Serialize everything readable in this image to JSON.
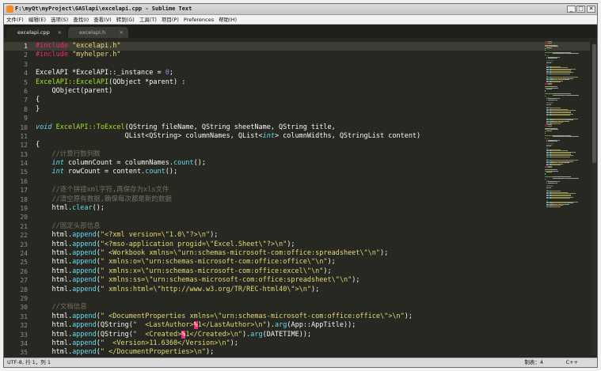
{
  "window": {
    "title": "F:\\myQt\\myProject\\GASlapi\\excelapi.cpp - Sublime Text",
    "buttons": {
      "minimize": "_",
      "maximize": "□",
      "close": "✕"
    }
  },
  "menu": [
    "文件(F)",
    "编辑(E)",
    "选项(S)",
    "查找(I)",
    "查看(V)",
    "转到(G)",
    "工具(T)",
    "项目(P)",
    "Preferences",
    "帮助(H)"
  ],
  "tabs": [
    {
      "label": "excelapi.cpp",
      "close": "×"
    },
    {
      "label": "excelapi.h",
      "close": "×"
    }
  ],
  "editor": {
    "colors": {
      "background": "#272822",
      "keyword": "#f92672",
      "string": "#e6db74",
      "number": "#ae81ff",
      "comment": "#75715e",
      "function": "#a6e22e",
      "type": "#66d9ef",
      "text": "#f8f8f2"
    },
    "line_numbers": [
      "1",
      "2",
      "3",
      "4",
      "5",
      "6",
      "7",
      "8",
      "9",
      "10",
      "11",
      "12",
      "13",
      "14",
      "15",
      "16",
      "17",
      "18",
      "19",
      "20",
      "21",
      "22",
      "23",
      "24",
      "25",
      "26",
      "27",
      "28",
      "29",
      "30",
      "31",
      "32",
      "33",
      "34",
      "35"
    ],
    "lines": [
      [
        [
          "#include ",
          "k"
        ],
        [
          "\"excelapi.h\"",
          "s"
        ]
      ],
      [
        [
          "#include ",
          "k"
        ],
        [
          "\"myhelper.h\"",
          "s"
        ]
      ],
      [],
      [
        [
          "ExcelAPI *ExcelAPI::_instance = ",
          ""
        ],
        [
          "0",
          "n"
        ],
        [
          ";",
          ""
        ]
      ],
      [
        [
          "ExcelAPI::ExcelAPI",
          "f"
        ],
        [
          "(QObject *parent) :",
          ""
        ]
      ],
      [
        [
          "    QObject(parent)",
          ""
        ]
      ],
      [
        [
          "{",
          ""
        ]
      ],
      [
        [
          "}",
          ""
        ]
      ],
      [],
      [
        [
          "void ",
          "t"
        ],
        [
          "ExcelAPI::ToExcel",
          "f"
        ],
        [
          "(QString fileName, QString sheetName, QString title,",
          ""
        ]
      ],
      [
        [
          "                      QList<QString> columnNames, QList<",
          ""
        ],
        [
          "int",
          "t"
        ],
        [
          "> columnWidths, QStringList content)",
          ""
        ]
      ],
      [
        [
          "{",
          ""
        ]
      ],
      [
        [
          "    //计算行数列数",
          "c"
        ]
      ],
      [
        [
          "    ",
          ""
        ],
        [
          "int",
          "t"
        ],
        [
          " columnCount = columnNames.",
          ""
        ],
        [
          "count",
          "m"
        ],
        [
          "();",
          ""
        ]
      ],
      [
        [
          "    ",
          ""
        ],
        [
          "int",
          "t"
        ],
        [
          " rowCount = content.",
          ""
        ],
        [
          "count",
          "m"
        ],
        [
          "();",
          ""
        ]
      ],
      [],
      [
        [
          "    //逐个拼接xml字符,再保存为xls文件",
          "c"
        ]
      ],
      [
        [
          "    //清空原有数据,确保每次都是新的数据",
          "c"
        ]
      ],
      [
        [
          "    html.",
          ""
        ],
        [
          "clear",
          "m"
        ],
        [
          "();",
          ""
        ]
      ],
      [],
      [
        [
          "    //固定头部信息",
          "c"
        ]
      ],
      [
        [
          "    html.",
          ""
        ],
        [
          "append",
          "m"
        ],
        [
          "(",
          ""
        ],
        [
          "\"<?xml version=\\\"1.0\\\"?>\\n\"",
          "s"
        ],
        [
          ");",
          ""
        ]
      ],
      [
        [
          "    html.",
          ""
        ],
        [
          "append",
          "m"
        ],
        [
          "(",
          ""
        ],
        [
          "\"<?mso-application progid=\\\"Excel.Sheet\\\"?>\\n\"",
          "s"
        ],
        [
          ");",
          ""
        ]
      ],
      [
        [
          "    html.",
          ""
        ],
        [
          "append",
          "m"
        ],
        [
          "(",
          ""
        ],
        [
          "\" <Workbook xmlns=\\\"urn:schemas-microsoft-com:office:spreadsheet\\\"\\n\"",
          "s"
        ],
        [
          ");",
          ""
        ]
      ],
      [
        [
          "    html.",
          ""
        ],
        [
          "append",
          "m"
        ],
        [
          "(",
          ""
        ],
        [
          "\" xmlns:o=\\\"urn:schemas-microsoft-com:office:office\\\"\\n\"",
          "s"
        ],
        [
          ");",
          ""
        ]
      ],
      [
        [
          "    html.",
          ""
        ],
        [
          "append",
          "m"
        ],
        [
          "(",
          ""
        ],
        [
          "\" xmlns:x=\\\"urn:schemas-microsoft-com:office:excel\\\"\\n\"",
          "s"
        ],
        [
          ");",
          ""
        ]
      ],
      [
        [
          "    html.",
          ""
        ],
        [
          "append",
          "m"
        ],
        [
          "(",
          ""
        ],
        [
          "\" xmlns:ss=\\\"urn:schemas-microsoft-com:office:spreadsheet\\\"\\n\"",
          "s"
        ],
        [
          ");",
          ""
        ]
      ],
      [
        [
          "    html.",
          ""
        ],
        [
          "append",
          "m"
        ],
        [
          "(",
          ""
        ],
        [
          "\" xmlns:html=\\\"http://www.w3.org/TR/REC-html40\\\">\\n\"",
          "s"
        ],
        [
          ");",
          ""
        ]
      ],
      [],
      [
        [
          "    //文档信息",
          "c"
        ]
      ],
      [
        [
          "    html.",
          ""
        ],
        [
          "append",
          "m"
        ],
        [
          "(",
          ""
        ],
        [
          "\" <DocumentProperties xmlns=\\\"urn:schemas-microsoft-com:office:office\\\">\\n\"",
          "s"
        ],
        [
          ");",
          ""
        ]
      ],
      [
        [
          "    html.",
          ""
        ],
        [
          "append",
          "m"
        ],
        [
          "(QString(",
          ""
        ],
        [
          "\"  <LastAuthor>",
          "s"
        ],
        [
          "%",
          "e"
        ],
        [
          "1</LastAuthor>\\n\"",
          "s"
        ],
        [
          ").",
          ""
        ],
        [
          "arg",
          "m"
        ],
        [
          "(App::AppTitle));",
          ""
        ]
      ],
      [
        [
          "    html.",
          ""
        ],
        [
          "append",
          "m"
        ],
        [
          "(QString(",
          ""
        ],
        [
          "\"  <Created>",
          "s"
        ],
        [
          "%",
          "e"
        ],
        [
          "1</Created>\\n\"",
          "s"
        ],
        [
          ").",
          ""
        ],
        [
          "arg",
          "m"
        ],
        [
          "(DATETIME));",
          ""
        ]
      ],
      [
        [
          "    html.",
          ""
        ],
        [
          "append",
          "m"
        ],
        [
          "(",
          ""
        ],
        [
          "\"  <Version>11.6360</Version>\\n\"",
          "s"
        ],
        [
          ");",
          ""
        ]
      ],
      [
        [
          "    html.",
          ""
        ],
        [
          "append",
          "m"
        ],
        [
          "(",
          ""
        ],
        [
          "\" </DocumentProperties>\\n\"",
          "s"
        ],
        [
          ");",
          ""
        ]
      ]
    ]
  },
  "status": {
    "position": "UTF-8, 行 1，列 1",
    "tab_size": "制表：4",
    "syntax": "C++"
  }
}
